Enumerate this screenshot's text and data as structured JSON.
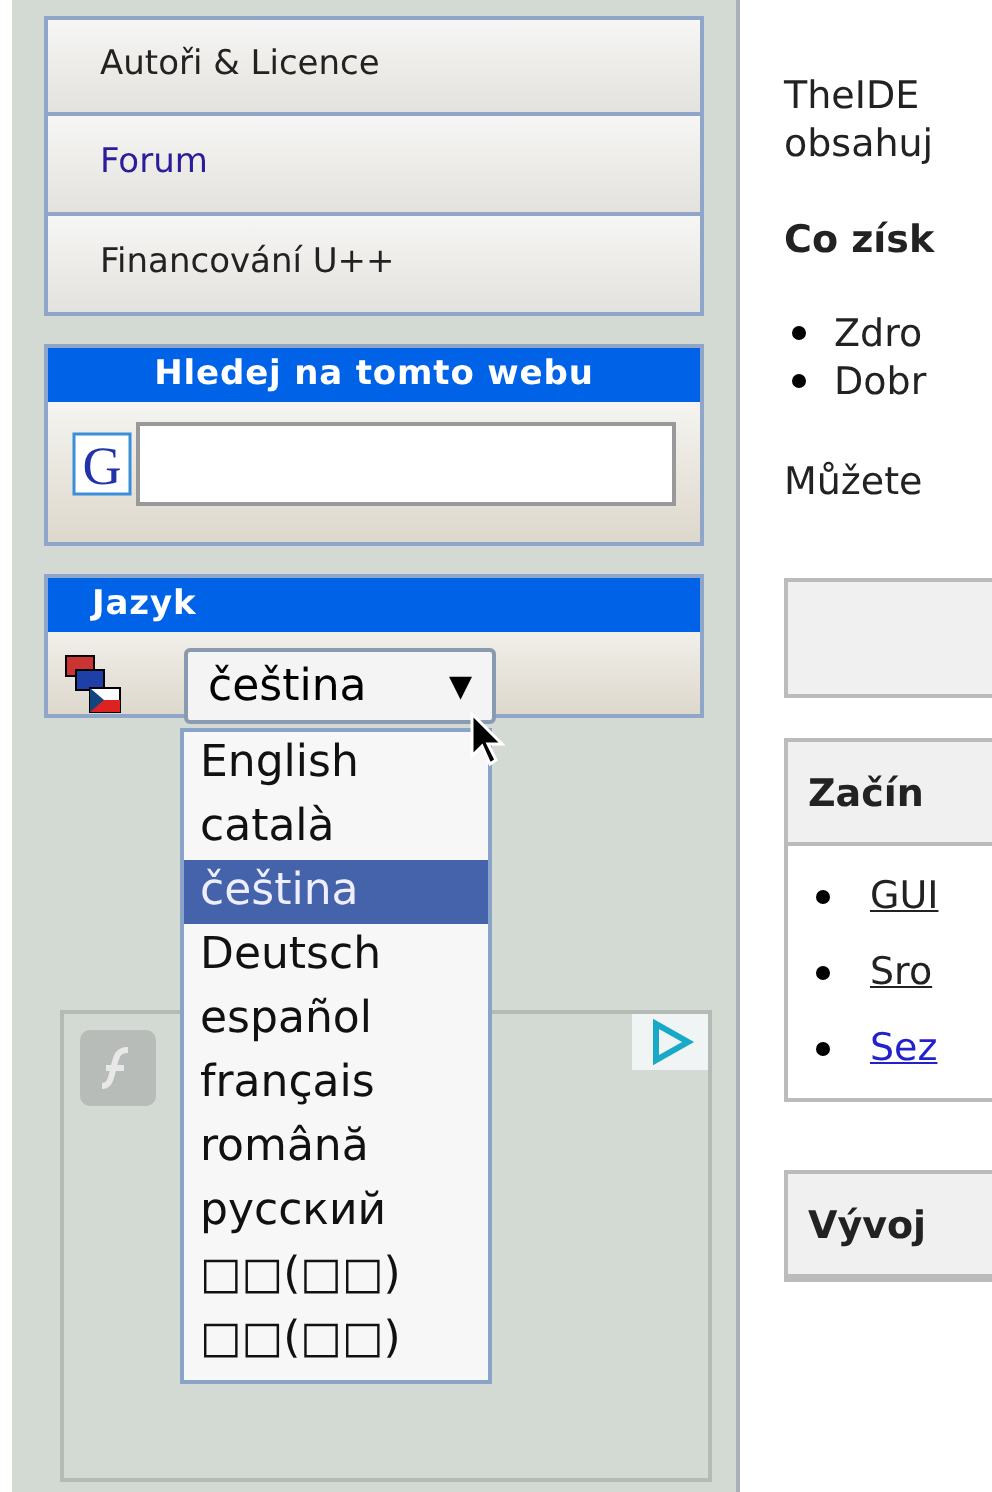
{
  "menu": [
    {
      "label": "Autoři & Licence",
      "kind": "plain"
    },
    {
      "label": "Forum",
      "kind": "link"
    },
    {
      "label": "Financování U++",
      "kind": "plain"
    }
  ],
  "search_box": {
    "title": "Hledej na tomto webu",
    "logo": "G"
  },
  "language_box": {
    "title": "Jazyk",
    "select": {
      "value": "čeština",
      "arrow": "▼",
      "expanded": true
    },
    "options": [
      {
        "label": "English",
        "selected": false
      },
      {
        "label": "català",
        "selected": false
      },
      {
        "label": "čeština",
        "selected": true
      },
      {
        "label": "Deutsch",
        "selected": false
      },
      {
        "label": "español",
        "selected": false
      },
      {
        "label": "français",
        "selected": false
      },
      {
        "label": "română",
        "selected": false
      },
      {
        "label": "русский",
        "selected": false
      },
      {
        "label": "□□(□□)",
        "selected": false
      },
      {
        "label": "□□(□□)",
        "selected": false
      }
    ]
  },
  "content": {
    "intro": [
      "TheIDE",
      "obsahuj"
    ],
    "heading": "Co získ",
    "bullets": [
      "Zdro",
      "Dobr"
    ],
    "paragraph": "Můžete",
    "panels": [
      {
        "title": "Začín",
        "links": [
          {
            "label": "GUI",
            "kind": "plain"
          },
          {
            "label": "Sro",
            "kind": "plain"
          },
          {
            "label": "Sez",
            "kind": "link"
          }
        ]
      },
      {
        "title": "Vývoj"
      }
    ]
  }
}
